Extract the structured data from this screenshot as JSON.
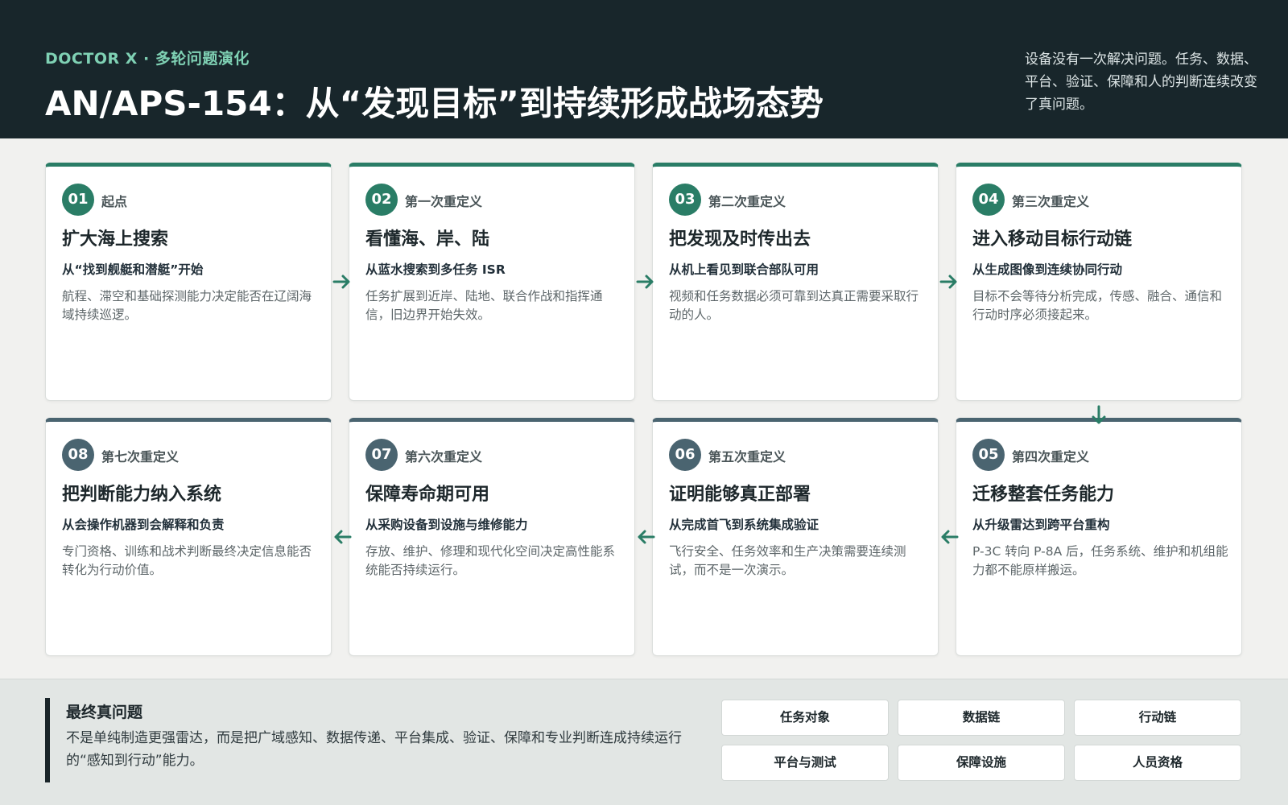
{
  "header": {
    "eyebrow": "DOCTOR X · 多轮问题演化",
    "title": "AN/APS-154：从“发现目标”到持续形成战场态势",
    "note": "设备没有一次解决问题。任务、数据、平台、验证、保障和人的判断连续改变了真问题。"
  },
  "colors": {
    "header_bg": "#18262b",
    "accent_green": "#2a7d66",
    "accent_slate": "#4a6470",
    "eyebrow": "#7fd1b4"
  },
  "stages": [
    {
      "num": "01",
      "stage": "起点",
      "title": "扩大海上搜索",
      "subtitle": "从“找到舰艇和潜艇”开始",
      "desc": "航程、滞空和基础探测能力决定能否在辽阔海域持续巡逻。"
    },
    {
      "num": "02",
      "stage": "第一次重定义",
      "title": "看懂海、岸、陆",
      "subtitle": "从蓝水搜索到多任务 ISR",
      "desc": "任务扩展到近岸、陆地、联合作战和指挥通信，旧边界开始失效。"
    },
    {
      "num": "03",
      "stage": "第二次重定义",
      "title": "把发现及时传出去",
      "subtitle": "从机上看见到联合部队可用",
      "desc": "视频和任务数据必须可靠到达真正需要采取行动的人。"
    },
    {
      "num": "04",
      "stage": "第三次重定义",
      "title": "进入移动目标行动链",
      "subtitle": "从生成图像到连续协同行动",
      "desc": "目标不会等待分析完成，传感、融合、通信和行动时序必须接起来。"
    },
    {
      "num": "05",
      "stage": "第四次重定义",
      "title": "迁移整套任务能力",
      "subtitle": "从升级雷达到跨平台重构",
      "desc": "P-3C 转向 P-8A 后，任务系统、维护和机组能力都不能原样搬运。"
    },
    {
      "num": "06",
      "stage": "第五次重定义",
      "title": "证明能够真正部署",
      "subtitle": "从完成首飞到系统集成验证",
      "desc": "飞行安全、任务效率和生产决策需要连续测试，而不是一次演示。"
    },
    {
      "num": "07",
      "stage": "第六次重定义",
      "title": "保障寿命期可用",
      "subtitle": "从采购设备到设施与维修能力",
      "desc": "存放、维护、修理和现代化空间决定高性能系统能否持续运行。"
    },
    {
      "num": "08",
      "stage": "第七次重定义",
      "title": "把判断能力纳入系统",
      "subtitle": "从会操作机器到会解释和负责",
      "desc": "专门资格、训练和战术判断最终决定信息能否转化为行动价值。"
    }
  ],
  "footer": {
    "title": "最终真问题",
    "text": "不是单纯制造更强雷达，而是把广域感知、数据传递、平台集成、验证、保障和专业判断连成持续运行的“感知到行动”能力。",
    "tags": [
      "任务对象",
      "数据链",
      "行动链",
      "平台与测试",
      "保障设施",
      "人员资格"
    ]
  }
}
